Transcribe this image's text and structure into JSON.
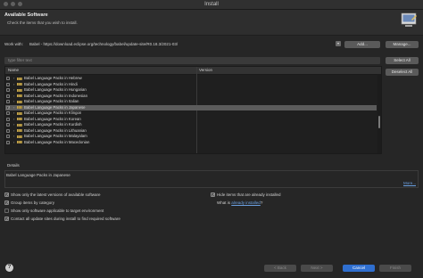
{
  "window": {
    "title": "Install"
  },
  "header": {
    "title": "Available Software",
    "subtitle": "Check the items that you wish to install."
  },
  "site": {
    "label": "Work with:",
    "value": "Babel - https://download.eclipse.org/technology/babel/update-site/R0.18.3/2021-03/",
    "add_button": "Add...",
    "manage_button": "Manage..."
  },
  "filter": {
    "placeholder": "type filter text"
  },
  "side_buttons": {
    "select_all": "Select All",
    "deselect_all": "Deselect All"
  },
  "table": {
    "columns": [
      "Name",
      "Version"
    ],
    "rows": [
      {
        "label": "Babel Language Packs in Hebrew",
        "checked": false,
        "selected": false
      },
      {
        "label": "Babel Language Packs in Hindi",
        "checked": false,
        "selected": false
      },
      {
        "label": "Babel Language Packs in Hungarian",
        "checked": false,
        "selected": false
      },
      {
        "label": "Babel Language Packs in Indonesian",
        "checked": false,
        "selected": false
      },
      {
        "label": "Babel Language Packs in Italian",
        "checked": false,
        "selected": false
      },
      {
        "label": "Babel Language Packs in Japanese",
        "checked": true,
        "selected": true
      },
      {
        "label": "Babel Language Packs in Klingon",
        "checked": false,
        "selected": false
      },
      {
        "label": "Babel Language Packs in Korean",
        "checked": false,
        "selected": false
      },
      {
        "label": "Babel Language Packs in Kurdish",
        "checked": false,
        "selected": false
      },
      {
        "label": "Babel Language Packs in Lithuanian",
        "checked": false,
        "selected": false
      },
      {
        "label": "Babel Language Packs in Malayalam",
        "checked": false,
        "selected": false
      },
      {
        "label": "Babel Language Packs in Macedonian",
        "checked": false,
        "selected": false
      }
    ]
  },
  "details": {
    "label": "Details",
    "text": "Babel Language Packs in Japanese",
    "more_link": "More..."
  },
  "options": {
    "latest_versions": {
      "label": "Show only the latest versions of available software",
      "checked": true
    },
    "group_by_category": {
      "label": "Group items by category",
      "checked": true
    },
    "target_env": {
      "label": "Show only software applicable to target environment",
      "checked": false
    },
    "contact_sites": {
      "label": "Contact all update sites during install to find required software",
      "checked": true
    },
    "hide_installed": {
      "label": "Hide items that are already installed",
      "checked": true
    },
    "what_is_prefix": "What is",
    "already_installed_link": "already installed",
    "what_is_suffix": "?"
  },
  "footer": {
    "back": "< Back",
    "next": "Next >",
    "cancel": "Cancel",
    "finish": "Finish"
  },
  "colors": {
    "accent_link": "#6a9fe0",
    "selected_row": "#5b5b5b",
    "cancel_button": "#2f6fd0"
  }
}
